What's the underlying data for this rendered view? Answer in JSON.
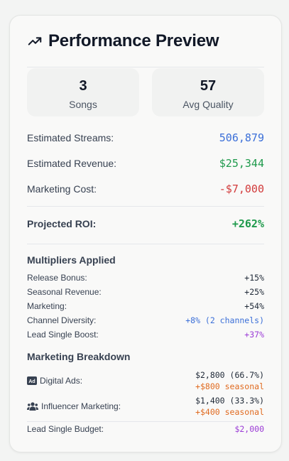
{
  "header": {
    "title": "Performance Preview",
    "icon": "trending-up-icon"
  },
  "stats": {
    "songs": {
      "value": "3",
      "label": "Songs"
    },
    "quality": {
      "value": "57",
      "label": "Avg Quality"
    }
  },
  "estimates": {
    "streams": {
      "label": "Estimated Streams:",
      "value": "506,879",
      "color": "#3b6fd8"
    },
    "revenue": {
      "label": "Estimated Revenue:",
      "value": "$25,344",
      "color": "#1f9a4c"
    },
    "cost": {
      "label": "Marketing Cost:",
      "value": "-$7,000",
      "color": "#d23b3b"
    }
  },
  "roi": {
    "label": "Projected ROI:",
    "value": "+262%",
    "color": "#1f9a4c"
  },
  "multipliers": {
    "title": "Multipliers Applied",
    "items": [
      {
        "label": "Release Bonus:",
        "value": "+15%",
        "color": "#1f2937"
      },
      {
        "label": "Seasonal Revenue:",
        "value": "+25%",
        "color": "#1f2937"
      },
      {
        "label": "Marketing:",
        "value": "+54%",
        "color": "#1f2937"
      },
      {
        "label": "Channel Diversity:",
        "value": "+8% (2 channels)",
        "color": "#3b6fd8"
      },
      {
        "label": "Lead Single Boost:",
        "value": "+37%",
        "color": "#9b3bd6"
      }
    ]
  },
  "marketing": {
    "title": "Marketing Breakdown",
    "items": [
      {
        "label": "Digital Ads:",
        "icon": "ad-icon",
        "amount": "$2,800 (66.7%)",
        "seasonal": "+$800 seasonal"
      },
      {
        "label": "Influencer Marketing:",
        "icon": "users-icon",
        "amount": "$1,400 (33.3%)",
        "seasonal": "+$400 seasonal"
      }
    ],
    "seasonal_color": "#e06a1f",
    "lead_budget": {
      "label": "Lead Single Budget:",
      "value": "$2,000",
      "color": "#9b3bd6"
    }
  }
}
